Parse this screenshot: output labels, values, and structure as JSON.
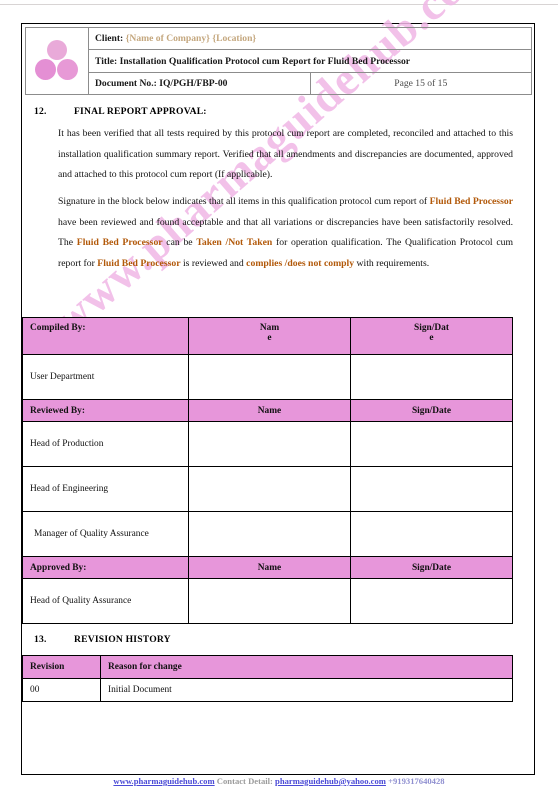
{
  "header": {
    "logo_name": "company-logo",
    "client_label": "Client:",
    "client_company": "{Name of Company}",
    "client_location": "{Location}",
    "title_line": "Title: Installation Qualification Protocol cum Report for Fluid Bed Processor",
    "document_no": "Document No.: IQ/PGH/FBP-00",
    "page_label": "Page 15 of 15"
  },
  "sections": {
    "s12": {
      "number": "12.",
      "title": "FINAL REPORT APPROVAL:"
    },
    "s13": {
      "number": "13.",
      "title": "REVISION HISTORY"
    }
  },
  "paragraphs": {
    "p1": "It has been verified that all tests required by this protocol cum report are completed, reconciled and attached to this installation qualification summary report. Verified that all amendments and discrepancies are documented, approved and attached to this protocol cum report (If applicable).",
    "p2_t1": "Signature in the block below indicates that all items in this qualification protocol cum report of ",
    "p2_h1": "Fluid Bed Processor",
    "p2_t2": " have been reviewed and found acceptable and that all variations or discrepancies have been satisfactorily resolved. The ",
    "p2_h2": "Fluid Bed Processor",
    "p2_t3": " can be ",
    "p2_h3": "Taken /Not Taken",
    "p2_t4": " for operation qualification. The Qualification Protocol cum report for ",
    "p2_h4": "Fluid Bed Processor",
    "p2_t5": " is reviewed and ",
    "p2_h5": "complies /does not comply",
    "p2_t6": " with requirements."
  },
  "approval_table": {
    "rows": [
      {
        "type": "header_split",
        "c1": "Compiled By:",
        "c2_line1": "Nam",
        "c2_line2": "e",
        "c3_line1": "Sign/Dat",
        "c3_line2": "e"
      },
      {
        "type": "data",
        "c1": "User Department",
        "c2": "",
        "c3": ""
      },
      {
        "type": "header",
        "c1": "Reviewed By:",
        "c2": "Name",
        "c3": "Sign/Date"
      },
      {
        "type": "data",
        "c1": "Head of Production",
        "c2": "",
        "c3": ""
      },
      {
        "type": "data",
        "c1": "Head of Engineering",
        "c2": "",
        "c3": ""
      },
      {
        "type": "data_indent",
        "c1": "Manager of Quality Assurance",
        "c2": "",
        "c3": ""
      },
      {
        "type": "header",
        "c1": "Approved By:",
        "c2": "Name",
        "c3": "Sign/Date"
      },
      {
        "type": "data",
        "c1": "Head of Quality Assurance",
        "c2": "",
        "c3": ""
      }
    ]
  },
  "revision_table": {
    "headers": {
      "revision": "Revision",
      "reason": "Reason for change"
    },
    "rows": [
      {
        "revision": "00",
        "reason": "Initial Document"
      }
    ]
  },
  "watermark": {
    "text": "www.pharmaguidehub.com"
  },
  "footer": {
    "website": "www.pharmaguidehub.com",
    "contact_label": "Contact Detail:",
    "email": "pharmaguidehub@yahoo.com",
    "phone": "+919317640428"
  },
  "colors": {
    "table_header_pink": "#e796da",
    "highlight_brown": "#b2590a",
    "placeholder_tan": "#c4a77e",
    "link_blue": "#4a4ad6",
    "watermark_pink": "#f0b7e6"
  }
}
